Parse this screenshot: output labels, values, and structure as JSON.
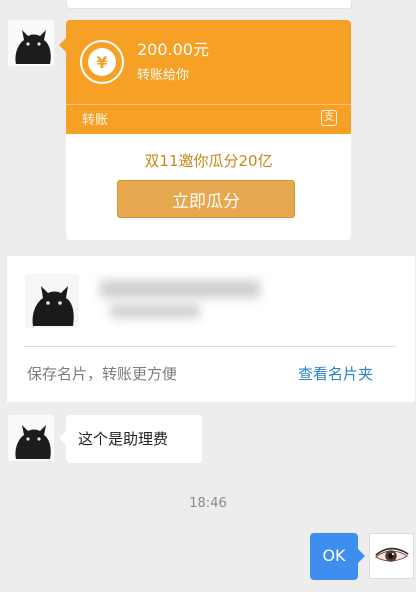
{
  "transfer": {
    "amount": "200.00元",
    "subtitle": "转账给你",
    "label": "转账",
    "icon": "transfer-icon",
    "icon_glyph": "¥",
    "brand_icon": "alipay-icon",
    "brand_glyph": "支",
    "promo": "双11邀你瓜分20亿",
    "claim_button": "立即瓜分",
    "colors": {
      "header": "#f6a126",
      "button": "#e6a84f",
      "promo_text": "#c8871b"
    }
  },
  "contact_card": {
    "hint": "保存名片，转账更方便",
    "link": "查看名片夹",
    "link_color": "#2c82c9"
  },
  "message": {
    "text": "这个是助理费"
  },
  "timestamp": "18:46",
  "own_message": {
    "text": "OK",
    "color": "#3e8ef0"
  }
}
